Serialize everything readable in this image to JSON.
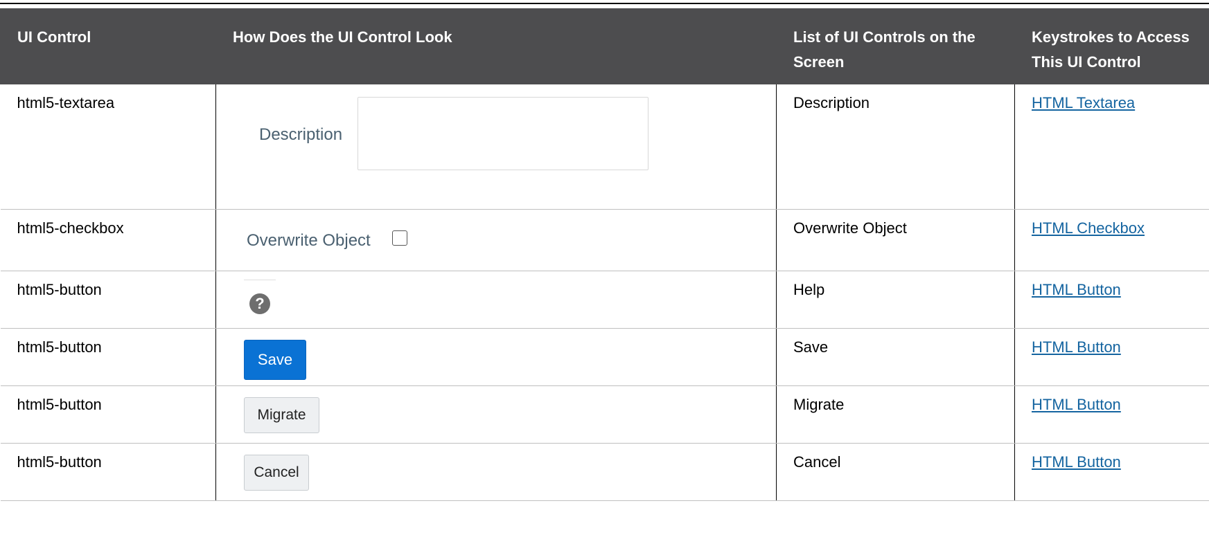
{
  "table": {
    "headers": [
      "UI Control",
      "How Does the UI Control Look",
      "List of UI Controls on the Screen",
      "Keystrokes to Access This UI Control"
    ],
    "rows": [
      {
        "control": "html5-textarea",
        "look_label": "Description",
        "list": "Description",
        "keystroke": "HTML Textarea"
      },
      {
        "control": "html5-checkbox",
        "look_label": "Overwrite Object",
        "list": "Overwrite Object",
        "keystroke": "HTML Checkbox"
      },
      {
        "control": "html5-button",
        "look_label": "?",
        "list": "Help",
        "keystroke": "HTML Button"
      },
      {
        "control": "html5-button",
        "look_label": "Save",
        "list": "Save",
        "keystroke": "HTML Button"
      },
      {
        "control": "html5-button",
        "look_label": "Migrate",
        "list": "Migrate",
        "keystroke": "HTML Button"
      },
      {
        "control": "html5-button",
        "look_label": "Cancel",
        "list": "Cancel",
        "keystroke": "HTML Button"
      }
    ]
  },
  "colors": {
    "header_bg": "#4d4d4f",
    "link": "#1464a0",
    "save_button": "#0a72d4"
  },
  "icons": {
    "help": "help-icon"
  }
}
